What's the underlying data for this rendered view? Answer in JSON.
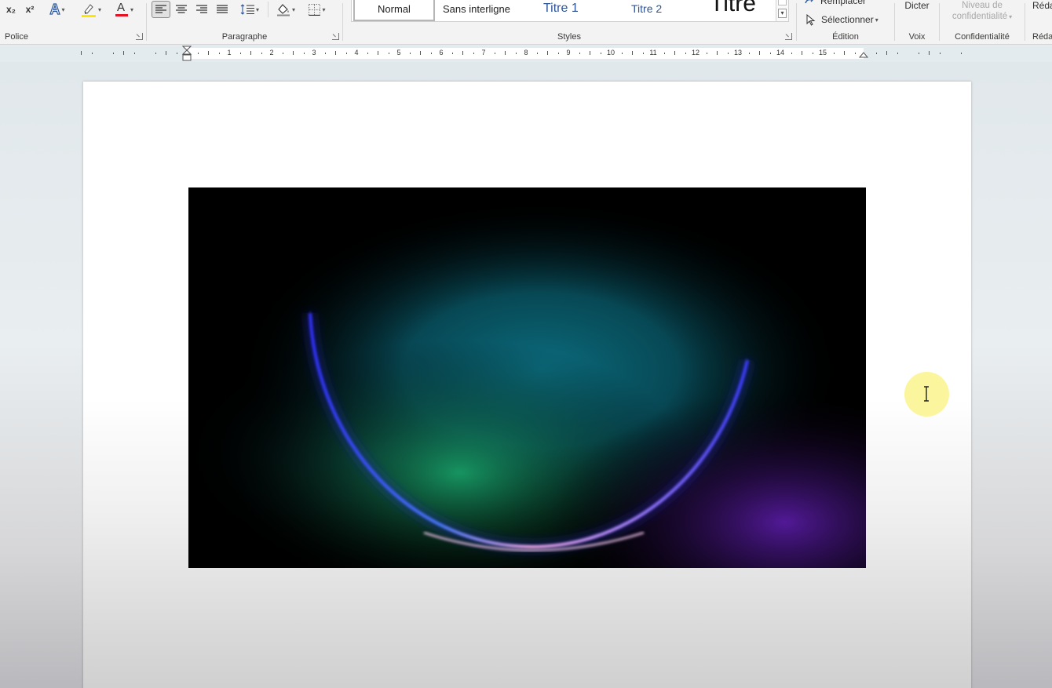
{
  "ribbon": {
    "police": {
      "label": "Police",
      "subscript": "x₂",
      "superscript": "x²",
      "text_effects": "A",
      "font_color": "A"
    },
    "paragraphe": {
      "label": "Paragraphe"
    },
    "styles": {
      "label": "Styles",
      "items": [
        "Normal",
        "Sans interligne",
        "Titre 1",
        "Titre 2",
        "Titre"
      ]
    },
    "edition": {
      "label": "Édition",
      "replace": "Remplacer",
      "select": "Sélectionner"
    },
    "voix": {
      "label": "Voix",
      "dictate": "Dicter"
    },
    "confidentialite": {
      "label": "Confidentialité",
      "level_line1": "Niveau de",
      "level_line2": "confidentialité"
    },
    "redaction": {
      "label": "Réda",
      "top": "Réda"
    }
  },
  "ruler": {
    "numbers": [
      "1",
      "2",
      "3",
      "4",
      "5",
      "6",
      "7",
      "8",
      "9",
      "10",
      "11",
      "12",
      "13",
      "14",
      "15"
    ]
  },
  "colors": {
    "highlight": "#ffe600",
    "font_color": "#e81123",
    "accent": "#2b579a"
  }
}
